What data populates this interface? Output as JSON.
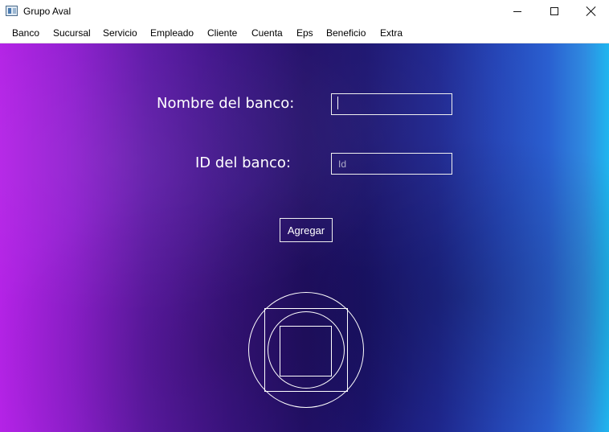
{
  "window": {
    "title": "Grupo Aval",
    "icon": "app-window-icon"
  },
  "menu": {
    "items": [
      "Banco",
      "Sucursal",
      "Servicio",
      "Empleado",
      "Cliente",
      "Cuenta",
      "Eps",
      "Beneficio",
      "Extra"
    ]
  },
  "form": {
    "bank_name_label": "Nombre del banco:",
    "bank_name_value": "",
    "bank_id_label": "ID del banco:",
    "bank_id_placeholder": "Id",
    "add_button_label": "Agregar"
  },
  "colors": {
    "gradient_left": "#b423e6",
    "gradient_mid": "#23106a",
    "gradient_right": "#1fb6ef",
    "foreground": "#ffffff"
  }
}
